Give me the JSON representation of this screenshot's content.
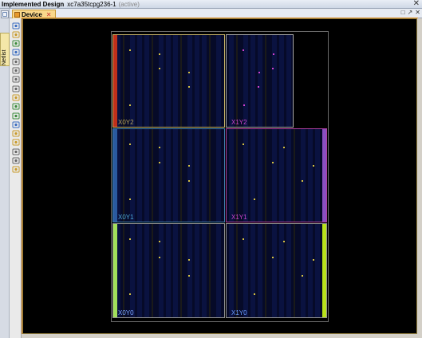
{
  "window": {
    "title": "Implemented Design",
    "part": "xc7a35tcpg236-1",
    "state": "(active)",
    "close_glyph": "✕"
  },
  "left_panel": {
    "netlist_tab": "Netlist"
  },
  "tabs": [
    {
      "label": "Device",
      "close_glyph": "✕",
      "active": true
    }
  ],
  "window_controls": [
    "□",
    "↗",
    "✕"
  ],
  "toolbar": {
    "buttons": [
      {
        "name": "select-mode-icon"
      },
      {
        "name": "properties-icon"
      },
      {
        "name": "back-arrow-icon"
      },
      {
        "name": "forward-arrow-icon"
      },
      {
        "name": "zoom-in-icon"
      },
      {
        "name": "zoom-out-icon"
      },
      {
        "name": "zoom-fit-icon"
      },
      {
        "name": "zoom-area-icon"
      },
      {
        "name": "auto-fit-selection-icon"
      },
      {
        "name": "refresh-icon"
      },
      {
        "name": "route-icon"
      },
      {
        "name": "show-io-icon"
      },
      {
        "name": "highlight-icon"
      },
      {
        "name": "draw-pblock-icon"
      },
      {
        "name": "mark-icon"
      },
      {
        "name": "ruler-icon"
      },
      {
        "name": "fit-icon"
      }
    ]
  },
  "clock_regions": [
    {
      "id": "X0Y2",
      "label": "X0Y2",
      "color": "#b7a35a",
      "border": "#c8b46a",
      "side": "left",
      "row": 0
    },
    {
      "id": "X1Y2",
      "label": "X1Y2",
      "color": "#cc44cc",
      "border": "#a8a8a8",
      "side": "right",
      "row": 0
    },
    {
      "id": "X0Y1",
      "label": "X0Y1",
      "color": "#4aa6d6",
      "border": "#3f7fb0",
      "side": "left",
      "row": 1
    },
    {
      "id": "X1Y1",
      "label": "X1Y1",
      "color": "#cc44cc",
      "border": "#b03fa0",
      "side": "right",
      "row": 1
    },
    {
      "id": "X0Y0",
      "label": "X0Y0",
      "color": "#7aa3ff",
      "border": "#909090",
      "side": "left",
      "row": 2
    },
    {
      "id": "X1Y0",
      "label": "X1Y0",
      "color": "#6a9cff",
      "border": "#909090",
      "side": "right",
      "row": 2
    }
  ],
  "colors": {
    "canvas_bg": "#000000",
    "column_fill": "#0a1240",
    "column_fill_dark": "#060a28",
    "io_bank_red": "#c0301a",
    "io_bank_purple": "#8a4fc0",
    "io_bank_green": "#a2e05a",
    "io_bank_lime": "#b8e21a",
    "io_bank_blue": "#2a5aa0",
    "tab_accent": "#f9d88b"
  }
}
